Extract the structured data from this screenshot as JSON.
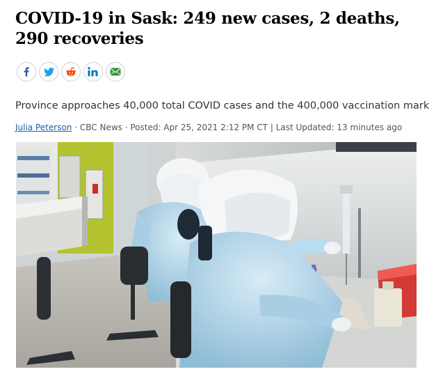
{
  "article": {
    "headline": "COVID-19 in Sask: 249 new cases, 2 deaths, 290 recoveries",
    "deck": "Province approaches 40,000 total COVID cases and the 400,000 vaccination mark",
    "byline": {
      "author": "Julia Peterson",
      "sep1": " · ",
      "source": "CBC News",
      "sep2": " · ",
      "posted": "Posted: Apr 25, 2021 2:12 PM CT",
      "sep3": " | ",
      "updated": "Last Updated: 13 minutes ago"
    }
  },
  "share": {
    "buttons": [
      {
        "icon": "facebook-icon",
        "color": "#3b5998"
      },
      {
        "icon": "twitter-icon",
        "color": "#1da1f2"
      },
      {
        "icon": "reddit-icon",
        "color": "#ff4500"
      },
      {
        "icon": "linkedin-icon",
        "color": "#0077b5"
      },
      {
        "icon": "email-icon",
        "color": "#2e7d32"
      }
    ]
  },
  "photo": {
    "subject": "lab-workers-in-protective-suits"
  }
}
